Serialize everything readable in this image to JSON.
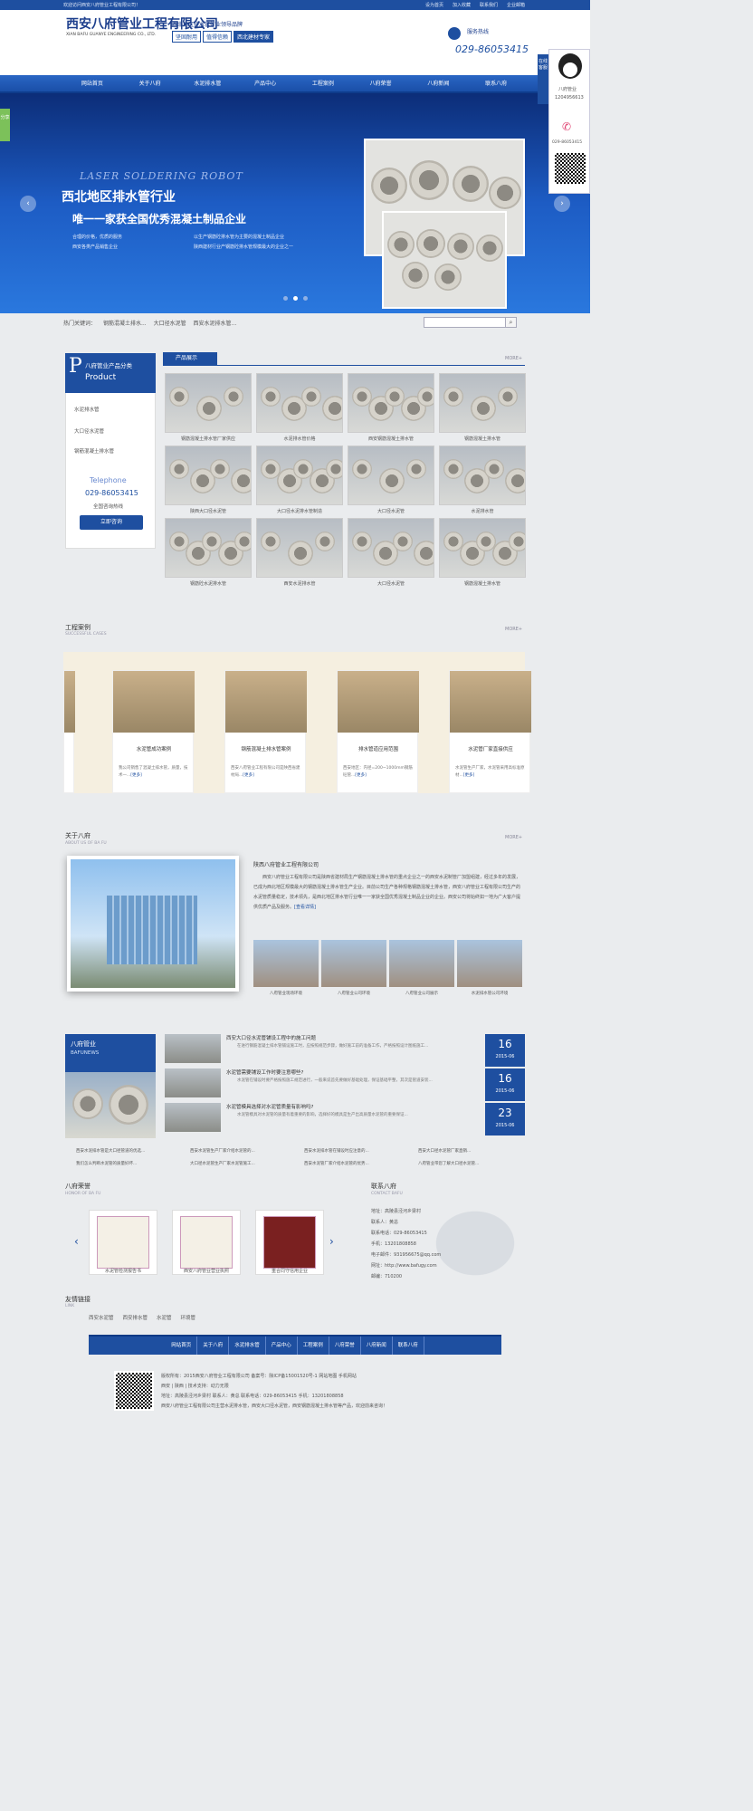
{
  "topbar": {
    "welcome": "欢迎访问西安八府管业工程有限公司！",
    "links": [
      "设为首页",
      "加入收藏",
      "联系我们",
      "企业邮箱"
    ]
  },
  "header": {
    "logo_cn": "西安八府管业工程有限公司",
    "logo_en": "XIAN BAFU GUANYE ENGINEERING CO., LTD.",
    "slogan": "西北地区排水管行业领导品牌",
    "tags": [
      "坚固耐用",
      "值得信赖",
      "西北建材专家"
    ],
    "service_label": "服务热线",
    "phone": "029-86053415"
  },
  "nav": [
    "网站首页",
    "关于八府",
    "水泥排水管",
    "产品中心",
    "工程案例",
    "八府荣誉",
    "八府新闻",
    "联系八府"
  ],
  "banner": {
    "en": "LASER SOLDERING ROBOT",
    "line1": "西北地区排水管行业",
    "line2": "唯一一家获全国优秀混凝土制品企业",
    "points": [
      "合理的价格，优质的服务",
      "西安各类产品销售企业",
      "以生产钢筋砼排水管为主要的混凝土制品企业",
      "陕西建材行业产钢筋砼排水管规模最大的企业之一"
    ]
  },
  "hot": {
    "label": "热门关键词：",
    "items": [
      "钢筋混凝土排水...",
      "大口径水泥管",
      "西安水泥排水管..."
    ]
  },
  "sidebar": {
    "cn": "八府管业产品分类",
    "en": "Product",
    "items": [
      "水泥排水管",
      "大口径水泥管",
      "钢筋混凝土排水管"
    ],
    "tel_label": "Telephone",
    "tel": "029-86053415",
    "hotline": "全国咨询热线",
    "consult": "立即咨询"
  },
  "products": {
    "title": "产品展示",
    "more": "MORE+",
    "items": [
      "钢筋混凝土排水管厂家供应",
      "水泥排水管价格",
      "西安钢筋混凝土排水管",
      "钢筋混凝土排水管",
      "陕西大口径水泥管",
      "大口径水泥排水管制造",
      "大口径水泥管",
      "水泥排水管",
      "钢筋砼水泥排水管",
      "西安水泥排水管",
      "大口径水泥管",
      "钢筋混凝土排水管"
    ]
  },
  "cases": {
    "title": "工程案例",
    "en": "SUCCESSFUL CASES",
    "more": "MORE+",
    "items": [
      {
        "title": "水泥管成功案例",
        "desc": "我公司销售了混凝土排水管，质量，技术一...",
        "more": "[更多]"
      },
      {
        "title": "钢筋混凝土排水管案例",
        "desc": "西安八府管业工程有限公司是陕西省建材局...",
        "more": "[更多]"
      },
      {
        "title": "排水管道应用范围",
        "desc": "西安地区：内径=200~1000mm钢筋砼管...",
        "more": "[更多]"
      },
      {
        "title": "水泥管厂家直接供应",
        "desc": "水泥管生产厂家，水泥管采用高标准原材...",
        "more": "[更多]"
      }
    ]
  },
  "about": {
    "title": "关于八府",
    "en": "ABOUT US OF BA FU",
    "more": "MORE+",
    "company": "陕西八府管业工程有限公司",
    "text": "西安八府管业工程有限公司是陕西省建材局生产钢筋混凝土排水管的重点企业之一的西安水泥制管厂加盟组建，经过多年的发展，已成为西北地区规模最大的钢筋混凝土排水管生产企业。目前公司生产各种规格钢筋混凝土排水管，西安八府管业工程有限公司生产的水泥管质量稳定，技术领先，是西北地区排水管行业唯一一家获全国优秀混凝土制品企业的企业。西安公司将始终如一地为广大客户提供优质产品及服务。",
    "more_link": "[查看详情]",
    "gallery": [
      "八府管业现场环境",
      "八府管业公司环境",
      "八府管业公司展示",
      "水泥排水管公司环境"
    ]
  },
  "news": {
    "cn": "八府管业",
    "en": "BAFUNEWS",
    "items": [
      {
        "title": "西安大口径水泥管铺设工程中的施工问题",
        "desc": "在进行钢筋混凝土排水管铺设施工时，应按照规范步骤，做好施工前的准备工作，严格按照设计图纸施工...",
        "day": "16",
        "ym": "2015-06"
      },
      {
        "title": "水泥管需要铺设工作时要注意哪些?",
        "desc": "水泥管在铺设时要严格按照施工规范进行，一般来说首先要做好基础处理，保证基础平整，其次是管道安装...",
        "day": "16",
        "ym": "2015-06"
      },
      {
        "title": "水泥管模具选择对水泥管质量有影响吗?",
        "desc": "水泥管模具对水泥管的质量有着重要的影响，选择好的模具是生产出高质量水泥管的重要保证...",
        "day": "23",
        "ym": "2015-06"
      }
    ],
    "links": [
      "西安水泥排水管是大口径管道的优选...",
      "西安水泥管生产厂家介绍水泥管的...",
      "西安水泥排水管在铺设时应注意的...",
      "西安大口径水泥管厂家直销...",
      "我们怎么判断水泥管的质量好坏...",
      "大口径水泥管生产厂家水泥管施工...",
      "西安水泥管厂家介绍水泥管的优势...",
      "八府管业带您了解大口径水泥管..."
    ]
  },
  "honor": {
    "title": "八府荣誉",
    "en": "HONOR OF BA FU",
    "items": [
      "水泥管检测报告书",
      "西安八府管业营业执照",
      "重合同守信用企业"
    ]
  },
  "contact": {
    "title": "联系八府",
    "en": "CONTACT BAFU",
    "lines": [
      "地址：高陵县泾河乡梁村",
      "联系人：黄总",
      "联系电话：029-86053415",
      "手机：13201808858",
      "电子邮件：931956675@qq.com",
      "网址：http://www.bafugy.com",
      "邮编：710200"
    ]
  },
  "friend": {
    "title": "友情链接",
    "en": "LINK",
    "items": [
      "西安水泥管",
      "西安排水管",
      "水泥管",
      "环境管"
    ]
  },
  "footer": {
    "nav": [
      "网站首页",
      "关于八府",
      "水泥排水管",
      "产品中心",
      "工程案例",
      "八府荣誉",
      "八府新闻",
      "联系八府"
    ],
    "l1": "版权所有：2015西安八府管业工程有限公司  备案号：陕ICP备15001520号-1  网站地图  手机网站",
    "l2": "西安 | 陕西 | 技术支持：动力无限",
    "l3": "地址：高陵县泾河乡梁村  联系人：黄总  联系电话：029-86053415  手机：13201808858",
    "l4": "西安八府管业工程有限公司主营水泥排水管，西安大口径水泥管，西安钢筋混凝土排水管等产品，欢迎前来咨询！"
  },
  "float": {
    "tab": "在线客服",
    "qq": "八府管业",
    "qq2": "1204956613",
    "tel": "029-86053415"
  },
  "share": "分享"
}
